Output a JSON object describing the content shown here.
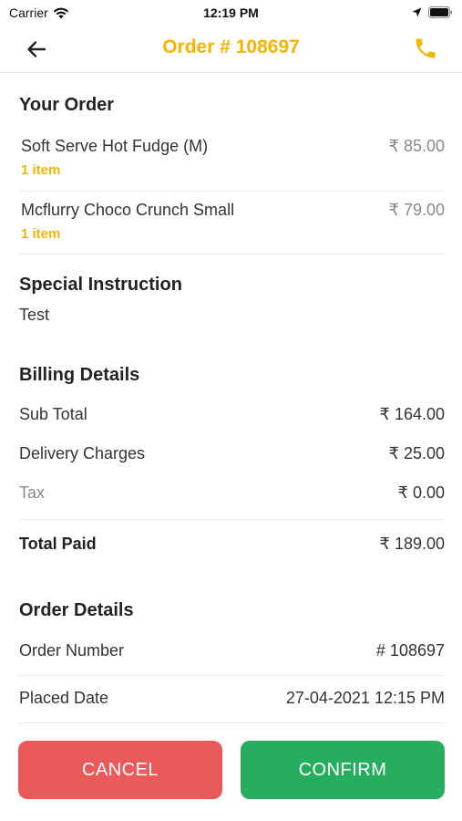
{
  "status_bar": {
    "carrier": "Carrier",
    "time": "12:19 PM"
  },
  "header": {
    "title": "Order # 108697"
  },
  "your_order": {
    "title": "Your Order",
    "items": [
      {
        "name": "Soft Serve Hot Fudge (M)",
        "qty": "1 item",
        "price": "₹ 85.00"
      },
      {
        "name": "Mcflurry Choco Crunch Small",
        "qty": "1 item",
        "price": "₹ 79.00"
      }
    ]
  },
  "special_instruction": {
    "title": "Special Instruction",
    "text": "Test"
  },
  "billing": {
    "title": "Billing Details",
    "sub_total_label": "Sub Total",
    "sub_total": "₹ 164.00",
    "delivery_label": "Delivery Charges",
    "delivery": "₹ 25.00",
    "tax_label": "Tax",
    "tax": "₹ 0.00",
    "total_label": "Total Paid",
    "total": "₹ 189.00"
  },
  "order_details": {
    "title": "Order Details",
    "number_label": "Order Number",
    "number": "# 108697",
    "date_label": "Placed Date",
    "date": "27-04-2021 12:15 PM"
  },
  "actions": {
    "cancel": "CANCEL",
    "confirm": "CONFIRM"
  },
  "colors": {
    "accent": "#f5b400",
    "cancel": "#eb5a5a",
    "confirm": "#26ad5e"
  }
}
